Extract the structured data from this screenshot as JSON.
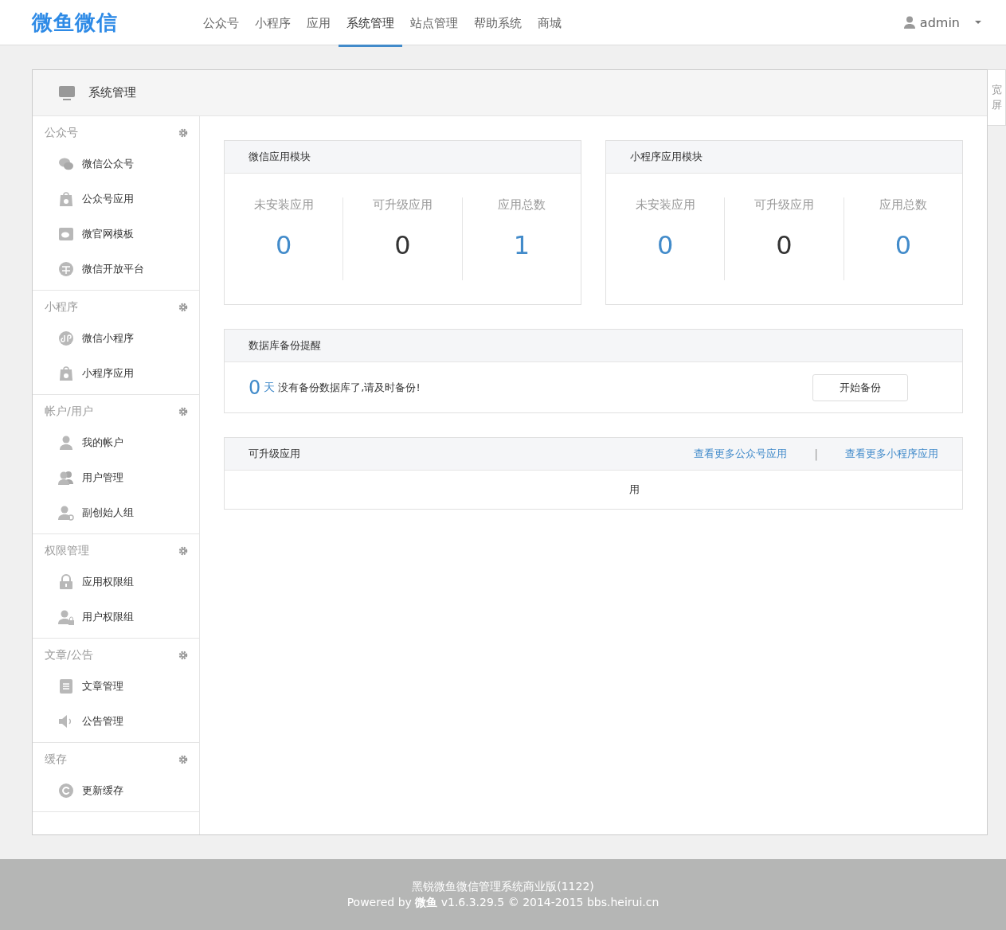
{
  "header": {
    "logo": "微鱼微信",
    "nav": [
      {
        "label": "公众号",
        "selected": false
      },
      {
        "label": "小程序",
        "selected": false
      },
      {
        "label": "应用",
        "selected": false
      },
      {
        "label": "系统管理",
        "selected": true
      },
      {
        "label": "站点管理",
        "selected": false
      },
      {
        "label": "帮助系统",
        "selected": false
      },
      {
        "label": "商城",
        "selected": false
      }
    ],
    "user": "admin"
  },
  "side_tab": "宽屏",
  "panel_title": "系统管理",
  "sidebar": [
    {
      "title": "公众号",
      "items": [
        {
          "label": "微信公众号",
          "kind": "wechat"
        },
        {
          "label": "公众号应用",
          "kind": "bag"
        },
        {
          "label": "微官网模板",
          "kind": "template"
        },
        {
          "label": "微信开放平台",
          "kind": "platform"
        }
      ]
    },
    {
      "title": "小程序",
      "items": [
        {
          "label": "微信小程序",
          "kind": "mini"
        },
        {
          "label": "小程序应用",
          "kind": "bag"
        }
      ]
    },
    {
      "title": "帐户/用户",
      "items": [
        {
          "label": "我的帐户",
          "kind": "user"
        },
        {
          "label": "用户管理",
          "kind": "users"
        },
        {
          "label": "副创始人组",
          "kind": "usergear"
        }
      ]
    },
    {
      "title": "权限管理",
      "items": [
        {
          "label": "应用权限组",
          "kind": "lock"
        },
        {
          "label": "用户权限组",
          "kind": "userlock"
        }
      ]
    },
    {
      "title": "文章/公告",
      "items": [
        {
          "label": "文章管理",
          "kind": "doc"
        },
        {
          "label": "公告管理",
          "kind": "speaker"
        }
      ]
    },
    {
      "title": "缓存",
      "items": [
        {
          "label": "更新缓存",
          "kind": "refresh"
        }
      ]
    }
  ],
  "modules": [
    {
      "title": "微信应用模块",
      "stats": [
        {
          "label": "未安装应用",
          "value": "0",
          "kind": "link"
        },
        {
          "label": "可升级应用",
          "value": "0",
          "kind": "plain"
        },
        {
          "label": "应用总数",
          "value": "1",
          "kind": "link"
        }
      ]
    },
    {
      "title": "小程序应用模块",
      "stats": [
        {
          "label": "未安装应用",
          "value": "0",
          "kind": "link"
        },
        {
          "label": "可升级应用",
          "value": "0",
          "kind": "plain"
        },
        {
          "label": "应用总数",
          "value": "0",
          "kind": "link"
        }
      ]
    }
  ],
  "backup": {
    "title": "数据库备份提醒",
    "days": "0",
    "unit": "天",
    "message": "没有备份数据库了,请及时备份!",
    "button": "开始备份"
  },
  "upgrade": {
    "title": "可升级应用",
    "links": [
      "查看更多公众号应用",
      "查看更多小程序应用"
    ],
    "separator": "|",
    "body": "用"
  },
  "footer": {
    "line1": "黑锐微鱼微信管理系统商业版(1122)",
    "line2": "Powered by **微鱼** v1.6.3.29.5 © 2014-2015 bbs.heirui.cn"
  }
}
